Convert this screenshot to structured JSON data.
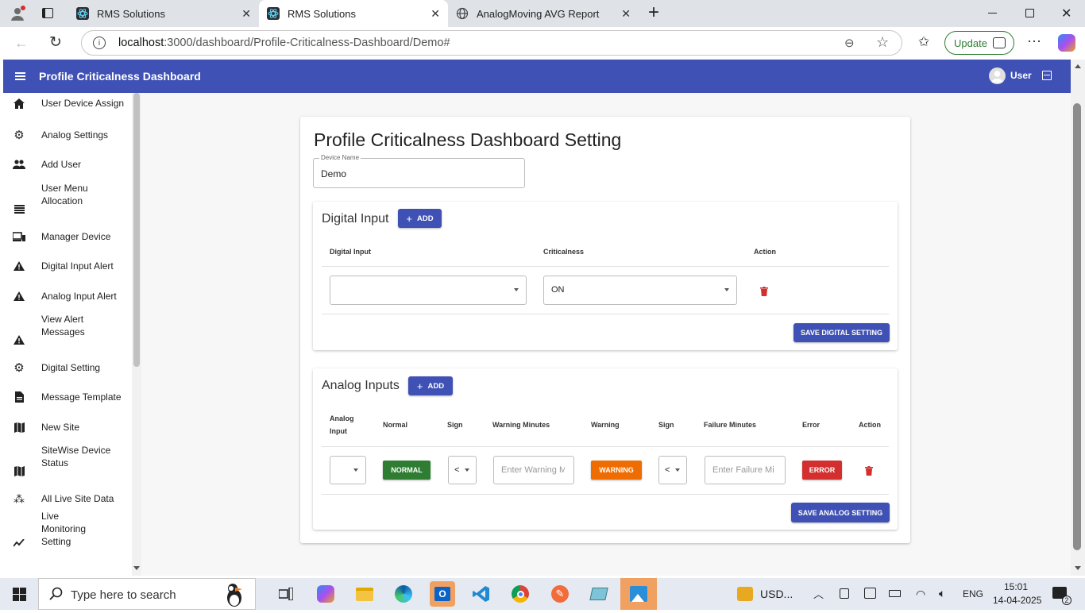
{
  "browser": {
    "tabs": [
      {
        "title": "RMS Solutions",
        "active": false
      },
      {
        "title": "RMS Solutions",
        "active": true
      },
      {
        "title": "AnalogMoving AVG Report",
        "active": false
      }
    ],
    "url_host": "localhost",
    "url_path": ":3000/dashboard/Profile-Criticalness-Dashboard/Demo#",
    "update_label": "Update"
  },
  "appbar": {
    "title": "Profile Criticalness Dashboard",
    "user_label": "User",
    "color": "#3f51b5"
  },
  "sidebar": {
    "items": [
      {
        "label": "User Device Assign",
        "icon": "home-icon"
      },
      {
        "label": "Analog Settings",
        "icon": "gear-icon"
      },
      {
        "label": "Add User",
        "icon": "people-icon"
      },
      {
        "label": "User Menu Allocation",
        "icon": "list-icon"
      },
      {
        "label": "Manager Device",
        "icon": "devices-icon"
      },
      {
        "label": "Digital Input Alert",
        "icon": "warning-icon"
      },
      {
        "label": "Analog Input Alert",
        "icon": "warning-icon"
      },
      {
        "label": "View Alert Messages",
        "icon": "warning-icon"
      },
      {
        "label": "Digital Setting",
        "icon": "gear-icon"
      },
      {
        "label": "Message Template",
        "icon": "document-icon"
      },
      {
        "label": "New Site",
        "icon": "map-icon"
      },
      {
        "label": "SiteWise Device Status",
        "icon": "map-icon"
      },
      {
        "label": "All Live Site Data",
        "icon": "burst-icon"
      },
      {
        "label": "Live Monitoring Setting",
        "icon": "chart-line-icon"
      }
    ]
  },
  "main": {
    "title": "Profile Criticalness Dashboard Setting",
    "device_name_label": "Device Name",
    "device_name_value": "Demo",
    "digital": {
      "title": "Digital Input",
      "add_label": "ADD",
      "headers": [
        "Digital Input",
        "Criticalness",
        "Action"
      ],
      "row": {
        "digital_input": "",
        "criticalness": "ON"
      },
      "save_label": "SAVE DIGITAL SETTING"
    },
    "analog": {
      "title": "Analog Inputs",
      "add_label": "ADD",
      "headers": {
        "analog_input": "Analog Input",
        "normal": "Normal",
        "sign1": "Sign",
        "warning_minutes": "Warning Minutes",
        "warning": "Warning",
        "sign2": "Sign",
        "failure_minutes": "Failure Minutes",
        "error": "Error",
        "action": "Action"
      },
      "row": {
        "normal_label": "NORMAL",
        "sign1": "<",
        "warning_placeholder": "Enter Warning M",
        "warning_label": "WARNING",
        "sign2": "<",
        "failure_placeholder": "Enter Failure Mi",
        "error_label": "ERROR"
      },
      "save_label": "SAVE ANALOG SETTING"
    },
    "colors": {
      "normal": "#2e7d32",
      "warning": "#ef6c00",
      "error": "#d32f2f",
      "primary": "#3f51b5"
    }
  },
  "taskbar": {
    "search_placeholder": "Type here to search",
    "weather_label": "USD...",
    "language": "ENG",
    "time": "15:01",
    "date": "14-04-2025",
    "notification_count": "2"
  }
}
